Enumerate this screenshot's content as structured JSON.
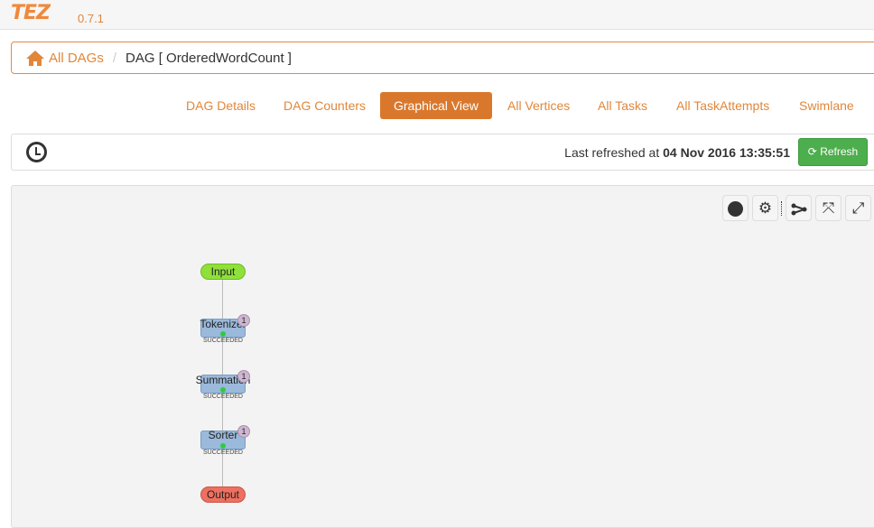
{
  "header": {
    "logo": "TEZ",
    "version": "0.7.1"
  },
  "breadcrumb": {
    "home": "All DAGs",
    "current": "DAG [ OrderedWordCount ]"
  },
  "tabs": [
    {
      "label": "DAG Details"
    },
    {
      "label": "DAG Counters"
    },
    {
      "label": "Graphical View",
      "active": true
    },
    {
      "label": "All Vertices"
    },
    {
      "label": "All Tasks"
    },
    {
      "label": "All TaskAttempts"
    },
    {
      "label": "Swimlane"
    }
  ],
  "refresh": {
    "prefix": "Last refreshed at",
    "timestamp": "04 Nov 2016 13:35:51",
    "button": "Refresh"
  },
  "graph": {
    "tools": [
      "record-icon",
      "settings-icon",
      "orientation-icon",
      "fit-icon",
      "fullscreen-icon"
    ],
    "input": "Input",
    "output": "Output",
    "vertices": [
      {
        "name": "Tokenizer",
        "tasks": "1",
        "status": "SUCCEEDED"
      },
      {
        "name": "Summation",
        "tasks": "1",
        "status": "SUCCEEDED"
      },
      {
        "name": "Sorter",
        "tasks": "1",
        "status": "SUCCEEDED"
      }
    ]
  },
  "colors": {
    "accent": "#e0873a",
    "active_tab": "#d9782d",
    "refresh": "#4cae4c",
    "input": "#8fe03a",
    "output": "#ee7060",
    "vertex": "#9bb9da"
  }
}
